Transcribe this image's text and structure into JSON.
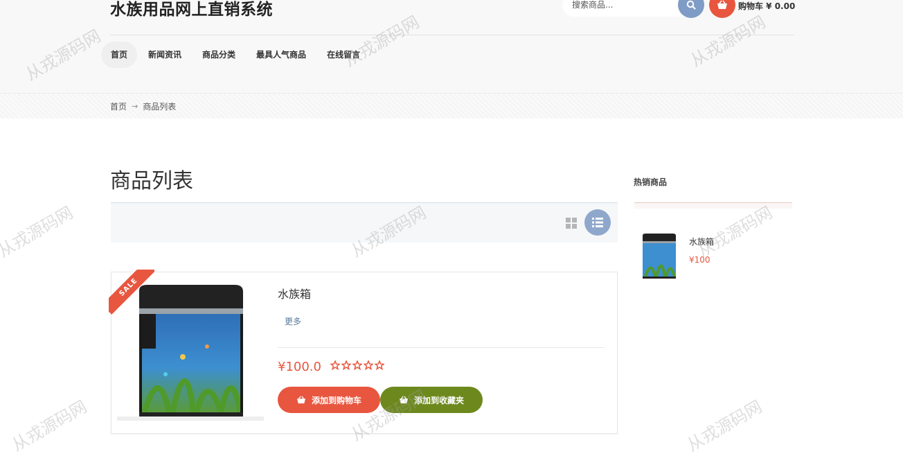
{
  "header": {
    "site_title": "水族用品网上直销系统",
    "search_placeholder": "搜索商品...",
    "cart_label": "购物车 ¥ 0.00"
  },
  "nav": {
    "items": [
      {
        "label": "首页",
        "active": true
      },
      {
        "label": "新闻资讯"
      },
      {
        "label": "商品分类"
      },
      {
        "label": "最具人气商品"
      },
      {
        "label": "在线留言"
      }
    ]
  },
  "breadcrumb": {
    "home": "首页",
    "separator": "→",
    "current": "商品列表"
  },
  "main": {
    "page_title": "商品列表",
    "product": {
      "sale_badge": "SALE",
      "name": "水族箱",
      "more_link": "更多",
      "price": "¥100.0",
      "rating": 0,
      "max_rating": 5,
      "add_to_cart": "添加到购物车",
      "add_to_favorites": "添加到收藏夹"
    }
  },
  "sidebar": {
    "title": "热销商品",
    "item": {
      "name": "水族箱",
      "price": "¥100"
    }
  },
  "watermark": "从戎源码网",
  "colors": {
    "accent_red": "#e8563f",
    "accent_green": "#6d891e",
    "accent_blue": "#8fa7cb"
  }
}
